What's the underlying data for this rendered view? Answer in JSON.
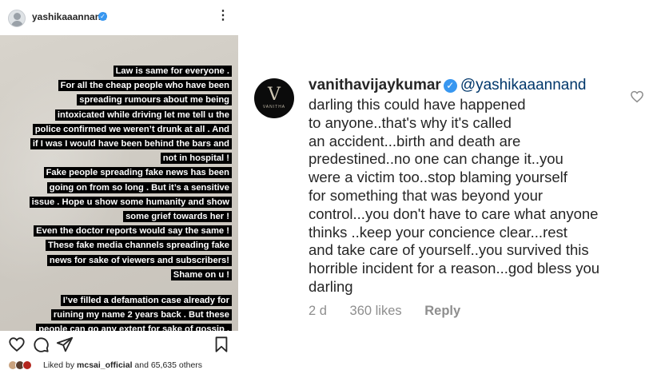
{
  "post": {
    "username": "yashikaaannand",
    "story_lines": [
      "Law is same for everyone .",
      "For all the cheap people  who have been",
      "spreading rumours about me being",
      "intoxicated while driving let me tell u the",
      "police confirmed we weren’t drunk at all . And",
      "if I was I would have been behind the bars and",
      "not in hospital !",
      "Fake people spreading fake news has been",
      "going on from so long . But it’s a sensitive",
      "issue . Hope u show some humanity and show",
      "some grief towards her !",
      "Even the doctor reports would say the same !",
      "These fake media channels spreading fake",
      "news for sake of viewers and subscribers!",
      "Shame on u !"
    ],
    "story_lines_2": [
      "I’ve filled a defamation case already for",
      "ruining my name 2 years back . But these",
      "people can go any extent for sake of gossip ."
    ],
    "liked_prefix": "Liked by",
    "liked_user": "mcsai_official",
    "liked_suffix": "and 65,635 others",
    "icons": [
      "more-icon",
      "heart-icon",
      "comment-icon",
      "share-icon",
      "bookmark-icon"
    ]
  },
  "comment": {
    "username": "vanithavijaykumar",
    "mention": "@yashikaaannand",
    "avatar_letter": "V",
    "avatar_text": "VANITHA",
    "lines": [
      "darling this could have happened",
      "to anyone..that's why it's called",
      "an accident...birth and death are",
      "predestined..no one can change it..you",
      "were a victim too..stop blaming yourself",
      "for something that was beyond your",
      "control...you don't have to care what anyone",
      "thinks ..keep your concience clear...rest",
      "and take care of yourself..you survived this",
      "horrible incident for a reason...god bless you",
      "darling"
    ],
    "time": "2 d",
    "likes": "360 likes",
    "reply": "Reply"
  },
  "colors": {
    "verified": "#3897f0",
    "mention": "#00376b",
    "meta": "#8e8e8e"
  }
}
